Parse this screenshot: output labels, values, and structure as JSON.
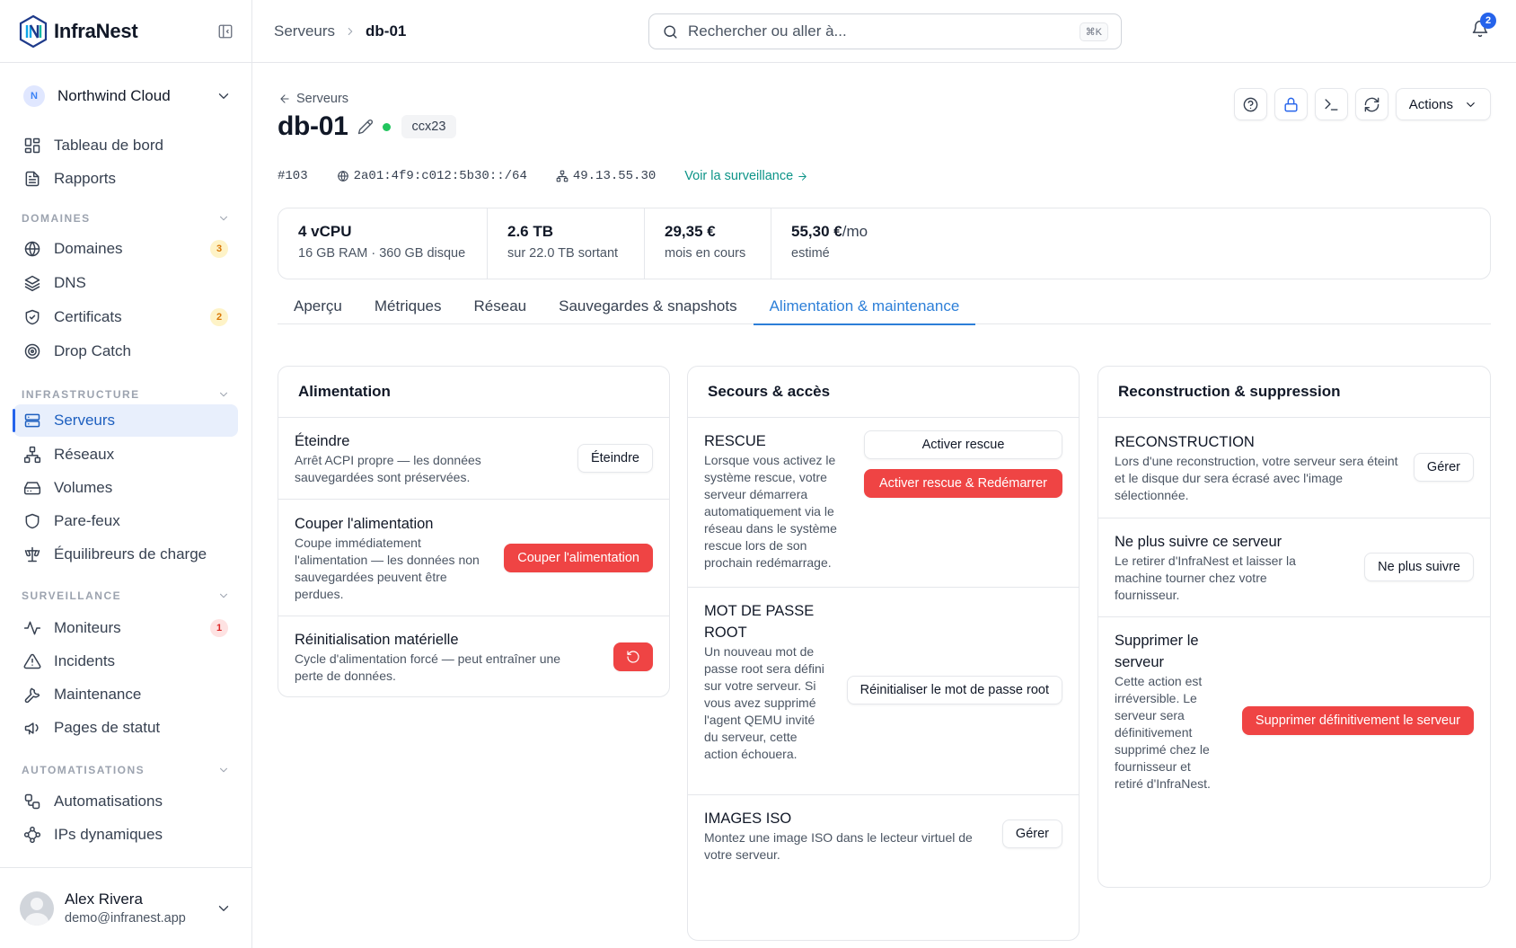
{
  "app": {
    "name": "InfraNest"
  },
  "sidebar": {
    "org": {
      "initial": "N",
      "name": "Northwind Cloud"
    },
    "top_items": [
      {
        "label": "Tableau de bord",
        "icon": "dashboard-icon"
      },
      {
        "label": "Rapports",
        "icon": "report-icon"
      }
    ],
    "sections": [
      {
        "title": "DOMAINES",
        "items": [
          {
            "label": "Domaines",
            "icon": "globe-icon",
            "badge": "3"
          },
          {
            "label": "DNS",
            "icon": "layers-icon"
          },
          {
            "label": "Certificats",
            "icon": "shield-check-icon",
            "badge": "2"
          },
          {
            "label": "Drop Catch",
            "icon": "target-icon"
          }
        ]
      },
      {
        "title": "INFRASTRUCTURE",
        "items": [
          {
            "label": "Serveurs",
            "icon": "server-icon",
            "active": true
          },
          {
            "label": "Réseaux",
            "icon": "network-icon"
          },
          {
            "label": "Volumes",
            "icon": "hard-drive-icon"
          },
          {
            "label": "Pare-feux",
            "icon": "shield-icon"
          },
          {
            "label": "Équilibreurs de charge",
            "icon": "scale-icon"
          }
        ]
      },
      {
        "title": "SURVEILLANCE",
        "items": [
          {
            "label": "Moniteurs",
            "icon": "activity-icon",
            "badge": "1"
          },
          {
            "label": "Incidents",
            "icon": "alert-triangle-icon"
          },
          {
            "label": "Maintenance",
            "icon": "wrench-icon"
          },
          {
            "label": "Pages de statut",
            "icon": "megaphone-icon"
          }
        ]
      },
      {
        "title": "AUTOMATISATIONS",
        "items": [
          {
            "label": "Automatisations",
            "icon": "workflow-icon"
          },
          {
            "label": "IPs dynamiques",
            "icon": "waypoints-icon"
          }
        ]
      }
    ],
    "user": {
      "name": "Alex Rivera",
      "email": "demo@infranest.app"
    }
  },
  "topbar": {
    "breadcrumb": [
      "Serveurs",
      "db-01"
    ],
    "search_placeholder": "Rechercher ou aller à...",
    "search_shortcut": "⌘K",
    "notifications": "2"
  },
  "server": {
    "back_label": "Serveurs",
    "name": "db-01",
    "type": "ccx23",
    "id": "#103",
    "ipv6": "2a01:4f9:c012:5b30::/64",
    "ipv4": "49.13.55.30",
    "monitoring_link": "Voir la surveillance",
    "actions_label": "Actions",
    "stats": [
      {
        "value": "4 vCPU",
        "unit": "",
        "label": "16 GB RAM · 360 GB disque"
      },
      {
        "value": "2.6 TB",
        "unit": "",
        "label": "sur 22.0 TB sortant"
      },
      {
        "value": "29,35 €",
        "unit": "",
        "label": "mois en cours"
      },
      {
        "value": "55,30 €",
        "unit": "/mo",
        "label": "estimé"
      }
    ],
    "tabs": [
      "Aperçu",
      "Métriques",
      "Réseau",
      "Sauvegardes & snapshots",
      "Alimentation & maintenance"
    ],
    "active_tab": "Alimentation & maintenance"
  },
  "power": {
    "title": "Alimentation",
    "shutdown": {
      "title": "Éteindre",
      "desc": "Arrêt ACPI propre — les données sauvegardées sont préservées.",
      "button": "Éteindre"
    },
    "poweroff": {
      "title": "Couper l'alimentation",
      "desc": "Coupe immédiatement l'alimentation — les données non sauvegardées peuvent être perdues.",
      "button": "Couper l'alimentation"
    },
    "reset": {
      "title": "Réinitialisation matérielle",
      "desc": "Cycle d'alimentation forcé — peut entraîner une perte de données."
    }
  },
  "rescue": {
    "title": "Secours & accès",
    "rescue": {
      "title": "RESCUE",
      "desc": "Lorsque vous activez le système rescue, votre serveur démarrera automatiquement via le réseau dans le système rescue lors de son prochain redémarrage.",
      "button1": "Activer rescue",
      "button2": "Activer rescue & Redémarrer"
    },
    "root_password": {
      "title": "MOT DE PASSE ROOT",
      "desc": "Un nouveau mot de passe root sera défini sur votre serveur. Si vous avez supprimé l'agent QEMU invité du serveur, cette action échouera.",
      "button": "Réinitialiser le mot de passe root"
    },
    "iso": {
      "title": "IMAGES ISO",
      "desc": "Montez une image ISO dans le lecteur virtuel de votre serveur.",
      "button": "Gérer"
    }
  },
  "rebuild": {
    "title": "Reconstruction & suppression",
    "rebuild": {
      "title": "RECONSTRUCTION",
      "desc": "Lors d'une reconstruction, votre serveur sera éteint et le disque dur sera écrasé avec l'image sélectionnée.",
      "button": "Gérer"
    },
    "untrack": {
      "title": "Ne plus suivre ce serveur",
      "desc": "Le retirer d'InfraNest et laisser la machine tourner chez votre fournisseur.",
      "button": "Ne plus suivre"
    },
    "delete": {
      "title": "Supprimer le serveur",
      "desc": "Cette action est irréversible. Le serveur sera définitivement supprimé chez le fournisseur et retiré d'InfraNest.",
      "button": "Supprimer définitivement le serveur"
    }
  }
}
